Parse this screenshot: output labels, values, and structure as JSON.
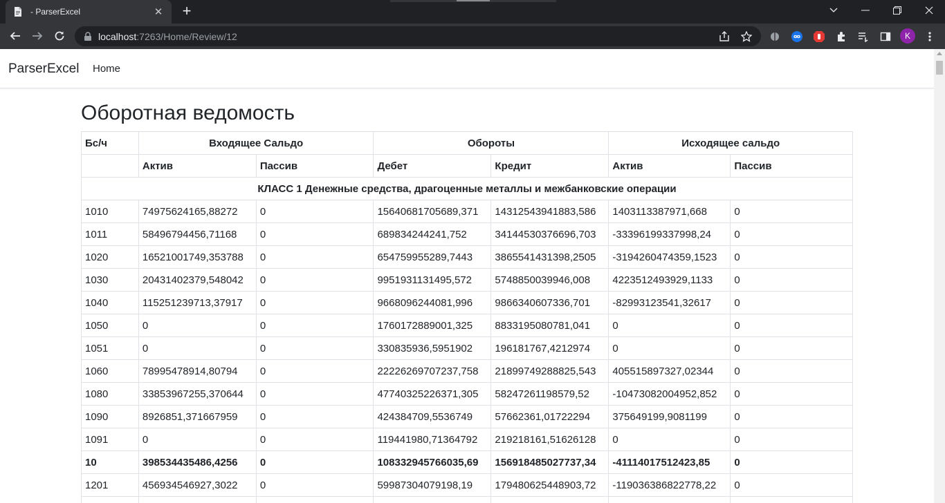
{
  "browser": {
    "tab_title": "- ParserExcel",
    "tab_close": "✕",
    "new_tab": "+",
    "url_host": "localhost",
    "url_path": ":7263/Home/Review/12",
    "profile_initial": "K"
  },
  "site": {
    "brand": "ParserExcel",
    "nav_home": "Home"
  },
  "page": {
    "title": "Оборотная ведомость"
  },
  "table": {
    "header_row1": {
      "account": "Бс/ч",
      "opening": "Входящее Сальдо",
      "turnover": "Обороты",
      "closing": "Исходящее сальдо"
    },
    "header_row2": [
      "",
      "Актив",
      "Пассив",
      "Дебет",
      "Кредит",
      "Актив",
      "Пассив"
    ],
    "class_title": "КЛАСС 1 Денежные средства, драгоценные металлы и межбанковские операции",
    "rows": [
      {
        "cells": [
          "1010",
          "74975624165,88272",
          "0",
          "15640681705689,371",
          "14312543941883,586",
          "1403113387971,668",
          "0"
        ]
      },
      {
        "cells": [
          "1011",
          "58496794456,71168",
          "0",
          "689834244241,752",
          "34144530376696,703",
          "-33396199337998,24",
          "0"
        ]
      },
      {
        "cells": [
          "1020",
          "16521001749,353788",
          "0",
          "654759955289,7443",
          "3865541431398,2505",
          "-3194260474359,1523",
          "0"
        ]
      },
      {
        "cells": [
          "1030",
          "20431402379,548042",
          "0",
          "9951931131495,572",
          "5748850039946,008",
          "4223512493929,1133",
          "0"
        ]
      },
      {
        "cells": [
          "1040",
          "115251239713,37917",
          "0",
          "9668096244081,996",
          "9866340607336,701",
          "-82993123541,32617",
          "0"
        ]
      },
      {
        "cells": [
          "1050",
          "0",
          "0",
          "1760172889001,325",
          "8833195080781,041",
          "0",
          "0"
        ]
      },
      {
        "cells": [
          "1051",
          "0",
          "0",
          "330835936,5951902",
          "196181767,4212974",
          "0",
          "0"
        ]
      },
      {
        "cells": [
          "1060",
          "78995478914,80794",
          "0",
          "22226269707237,758",
          "21899749288825,543",
          "405515897327,02344",
          "0"
        ]
      },
      {
        "cells": [
          "1080",
          "33853967255,370644",
          "0",
          "47740325226371,305",
          "58247261198579,52",
          "-10473082004952,852",
          "0"
        ]
      },
      {
        "cells": [
          "1090",
          "8926851,371667959",
          "0",
          "424384709,5536749",
          "57662361,01722294",
          "375649199,9081199",
          "0"
        ]
      },
      {
        "cells": [
          "1091",
          "0",
          "0",
          "119441980,71364792",
          "219218161,51626128",
          "0",
          "0"
        ]
      },
      {
        "cells": [
          "10",
          "398534435486,4256",
          "0",
          "108332945766035,69",
          "156918485027737,34",
          "-41114017512423,85",
          "0"
        ],
        "total": true
      },
      {
        "cells": [
          "1201",
          "456934546927,3022",
          "0",
          "59987304079198,19",
          "179480625448903,72",
          "-119036386822778,22",
          "0"
        ]
      },
      {
        "cells": [
          "",
          "",
          "",
          "",
          "",
          "",
          ""
        ]
      }
    ]
  }
}
